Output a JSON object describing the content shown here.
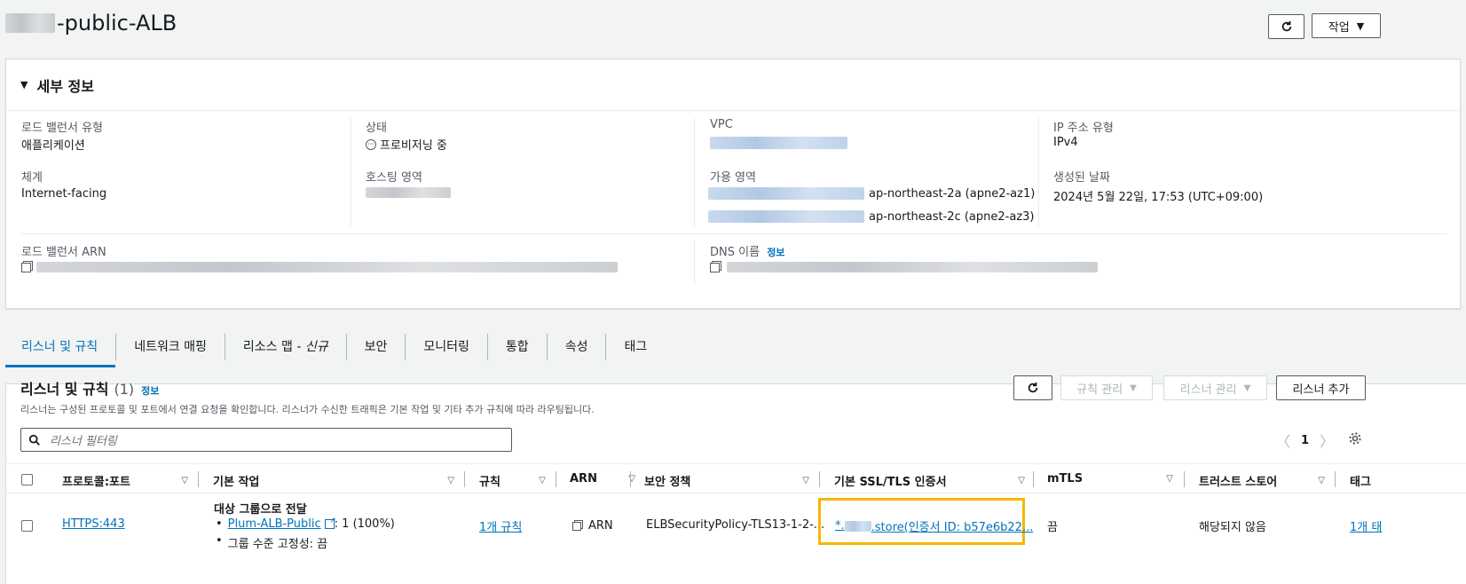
{
  "page": {
    "title_suffix": "-public-ALB",
    "refresh_icon": "refresh-icon",
    "actions_label": "작업"
  },
  "details": {
    "heading": "세부 정보",
    "lb_type_label": "로드 밸런서 유형",
    "lb_type_value": "애플리케이션",
    "scheme_label": "체계",
    "scheme_value": "Internet-facing",
    "state_label": "상태",
    "state_value": "프로비저닝 중",
    "hosted_zone_label": "호스팅 영역",
    "vpc_label": "VPC",
    "az_label": "가용 영역",
    "az1": "ap-northeast-2a (apne2-az1)",
    "az2": "ap-northeast-2c (apne2-az3)",
    "ip_type_label": "IP 주소 유형",
    "ip_type_value": "IPv4",
    "created_label": "생성된 날짜",
    "created_value": "2024년 5월 22일, 17:53 (UTC+09:00)",
    "arn_label": "로드 밸런서 ARN",
    "dns_label": "DNS 이름",
    "dns_info": "정보"
  },
  "tabs": [
    "리스너 및 규칙",
    "네트워크 매핑",
    "리소스 맵 - ",
    "보안",
    "모니터링",
    "통합",
    "속성",
    "태그"
  ],
  "tab_new": "신규",
  "listeners": {
    "heading": "리스너 및 규칙",
    "count": "(1)",
    "info": "정보",
    "description": "리스너는 구성된 프로토콜 및 포트에서 연결 요청을 확인합니다. 리스너가 수신한 트래픽은 기본 작업 및 기타 추가 규칙에 따라 라우팅됩니다.",
    "manage_rules": "규칙 관리",
    "manage_listener": "리스너 관리",
    "add_listener": "리스너 추가",
    "filter_placeholder": "리스너 필터링",
    "page": "1",
    "columns": [
      "프로토콜:포트",
      "기본 작업",
      "규칙",
      "ARN",
      "보안 정책",
      "기본 SSL/TLS 인증서",
      "mTLS",
      "트러스트 스토어",
      "태그"
    ],
    "row": {
      "protocol": "HTTPS:443",
      "action_title": "대상 그룹으로 전달",
      "target_group": "Plum-ALB-Public",
      "target_weight": ": 1 (100%)",
      "stickiness": "그룹 수준 고정성: 끔",
      "rules": "1개 규칙",
      "arn": "ARN",
      "policy": "ELBSecurityPolicy-TLS13-1-2-...",
      "cert_prefix": "*.",
      "cert_suffix": ".store(인증서 ID: b57e6b22...",
      "mtls": "끔",
      "trust_store": "해당되지 않음",
      "tags": "1개 태"
    }
  },
  "colors": {
    "link": "#0073bb",
    "highlight": "#f5b800",
    "active_tab": "#0073bb"
  }
}
